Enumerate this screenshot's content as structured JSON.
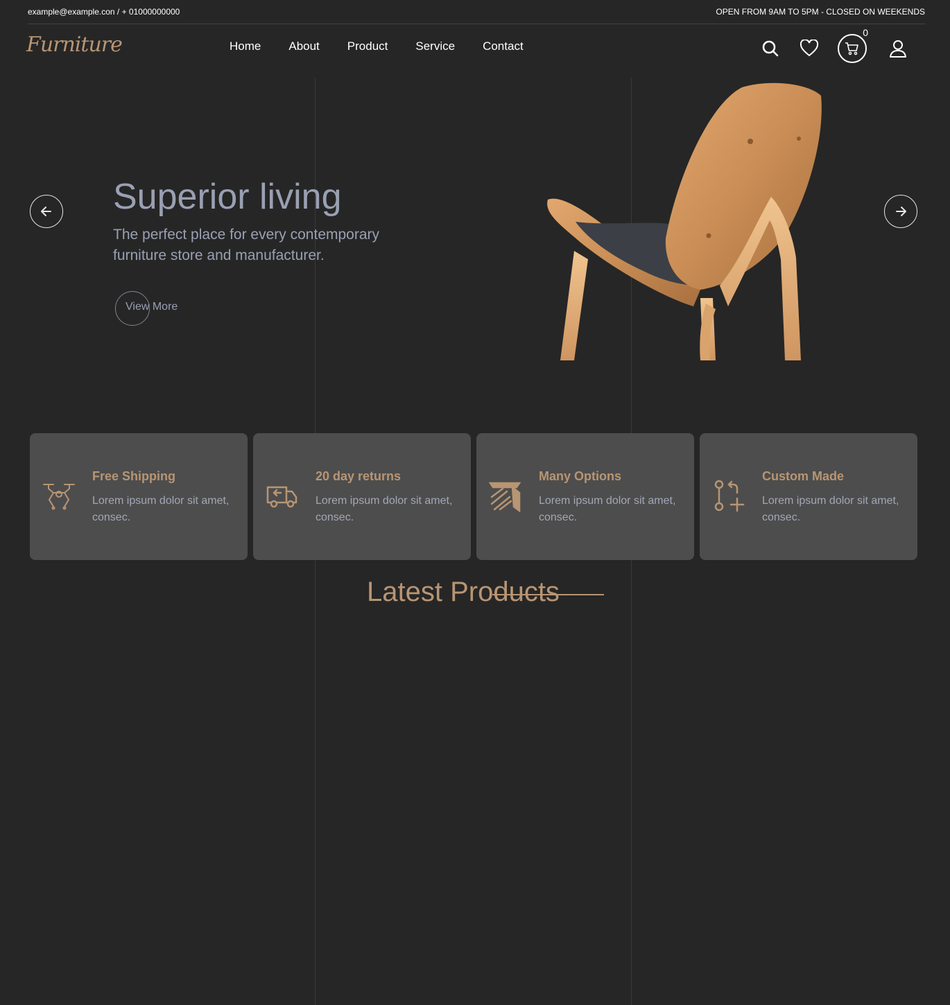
{
  "topbar": {
    "contact": "example@example.con / + 01000000000",
    "hours": "OPEN FROM 9AM TO 5PM - CLOSED ON WEEKENDS"
  },
  "header": {
    "logo": "Furniture",
    "nav": [
      "Home",
      "About",
      "Product",
      "Service",
      "Contact"
    ],
    "cart_count": "0"
  },
  "hero": {
    "title": "Superior living",
    "subtitle": "The perfect place for every contemporary furniture store and manufacturer.",
    "cta": "View More"
  },
  "features": [
    {
      "title": "Free Shipping",
      "text": "Lorem ipsum dolor sit amet, consec.",
      "icon": "drone-icon"
    },
    {
      "title": "20 day returns",
      "text": "Lorem ipsum dolor sit amet, consec.",
      "icon": "return-truck-icon"
    },
    {
      "title": "Many Options",
      "text": "Lorem ipsum dolor sit amet, consec.",
      "icon": "options-icon"
    },
    {
      "title": "Custom Made",
      "text": "Lorem ipsum dolor sit amet, consec.",
      "icon": "git-branch-plus-icon"
    }
  ],
  "latest": {
    "title": "Latest Products"
  },
  "colors": {
    "accent": "#b89573",
    "background": "#262626",
    "card": "#4d4d4d",
    "muted_text": "#9aa0b3"
  }
}
